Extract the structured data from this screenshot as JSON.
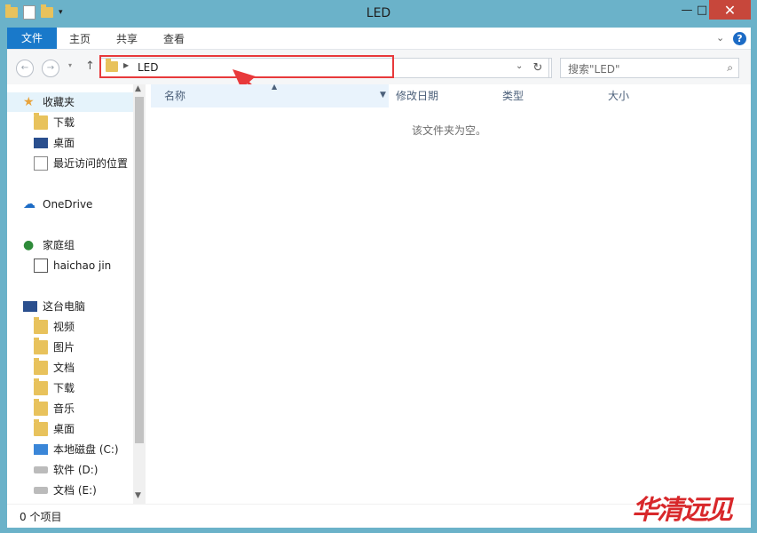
{
  "window": {
    "title": "LED"
  },
  "ribbon": {
    "file": "文件",
    "tabs": [
      "主页",
      "共享",
      "查看"
    ]
  },
  "address": {
    "path": "LED",
    "search_placeholder": "搜索\"LED\""
  },
  "columns": [
    "名称",
    "修改日期",
    "类型",
    "大小"
  ],
  "empty_text": "该文件夹为空。",
  "status": "0 个项目",
  "sidebar": {
    "favorites": "收藏夹",
    "fav_items": [
      "下载",
      "桌面",
      "最近访问的位置"
    ],
    "onedrive": "OneDrive",
    "homegroup": "家庭组",
    "home_user": "haichao jin",
    "thispc": "这台电脑",
    "pc_items": [
      "视频",
      "图片",
      "文档",
      "下载",
      "音乐",
      "桌面",
      "本地磁盘 (C:)",
      "软件 (D:)",
      "文档 (E:)"
    ]
  },
  "watermark": "华清远见",
  "colors": {
    "file_tab": "#1979ca",
    "close": "#c7473b",
    "highlight": "#e8393b",
    "frame": "#6bb2c9"
  }
}
